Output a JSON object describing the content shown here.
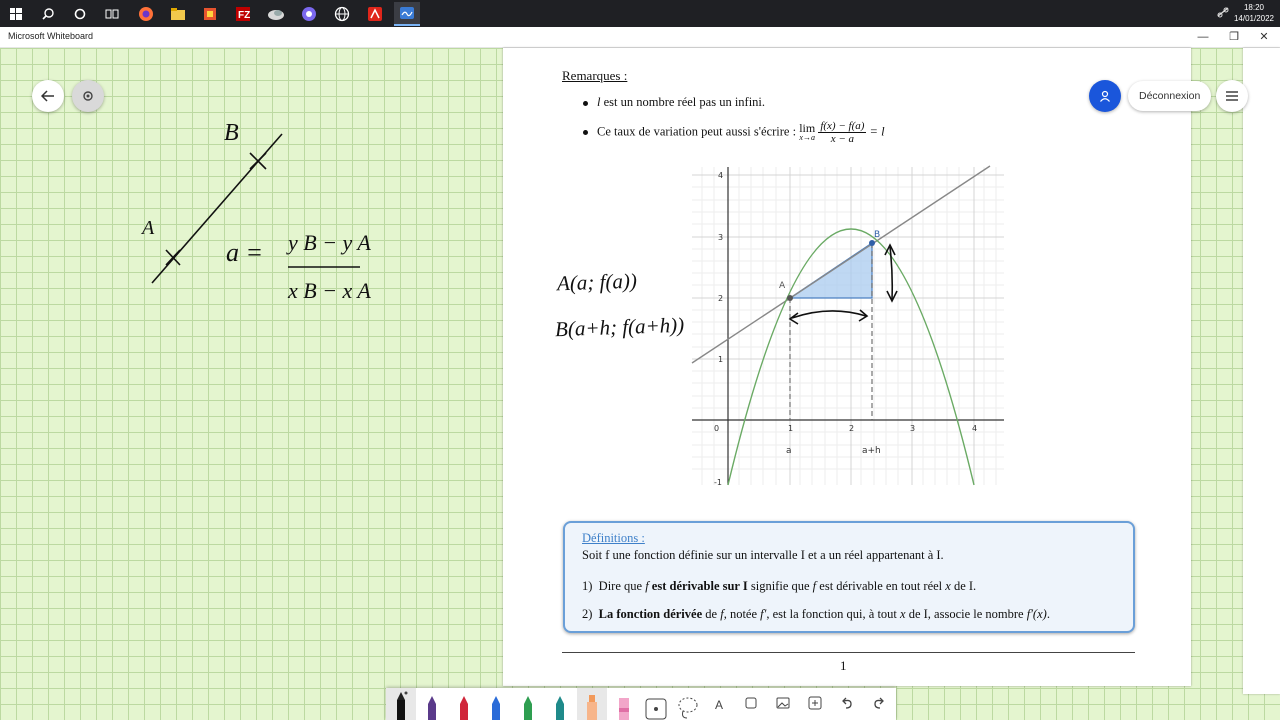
{
  "taskbar": {
    "clock_time": "18:20",
    "clock_date": "14/01/2022"
  },
  "window": {
    "title": "Microsoft Whiteboard",
    "minimize": "—",
    "maximize": "❐",
    "close": "✕"
  },
  "header": {
    "logout_label": "Déconnexion"
  },
  "document": {
    "remarks_title": "Remarques :",
    "bullet1_var": "l",
    "bullet1_text": " est un nombre réel pas un infini.",
    "bullet2_text": "Ce taux de variation peut aussi s'écrire : ",
    "lim_word": "lim",
    "lim_sub": "x→a",
    "frac_num": "f(x) − f(a)",
    "frac_den": "x − a",
    "lim_result": "= l",
    "graph": {
      "x_ticks": [
        "0",
        "1",
        "2",
        "3",
        "4"
      ],
      "y_ticks": [
        "-1",
        "1",
        "2",
        "3",
        "4"
      ],
      "point_a": "A",
      "point_b": "B",
      "label_a": "a",
      "label_ah": "a+h"
    },
    "definitions": {
      "title": "Définitions :",
      "intro": "Soit f une fonction définie sur un intervalle I et a un réel appartenant à I.",
      "item1_num": "1)",
      "item1_a": "Dire que ",
      "item1_f": "f",
      "item1_bold": " est dérivable sur I",
      "item1_b": " signifie que ",
      "item1_f2": "f",
      "item1_c": " est dérivable en tout réel ",
      "item1_x": "x",
      "item1_d": " de I.",
      "item2_num": "2)",
      "item2_bold": "La fonction dérivée",
      "item2_a": " de ",
      "item2_f": "f",
      "item2_b": ", notée ",
      "item2_fp": "f′",
      "item2_c": ", est la fonction qui, à tout ",
      "item2_x": "x",
      "item2_d": " de I, associe le nombre ",
      "item2_fpx": "f′(x)",
      "item2_e": "."
    },
    "page_number": "1"
  },
  "handwriting": {
    "label_B": "B",
    "label_A": "A",
    "formula_lhs": "a =",
    "formula_num": "y B − y A",
    "formula_den": "x B − x A",
    "coord_A": "A(a; f(a))",
    "coord_B": "B(a+h; f(a+h))"
  },
  "colors": {
    "grid_bg": "#e4f5cf",
    "accent_blue": "#1a56db",
    "def_border": "#6a9fd8",
    "curve_green": "#6aaa64",
    "triangle_fill": "#a9cbef"
  },
  "toolbar": {
    "text_tool": "A"
  }
}
